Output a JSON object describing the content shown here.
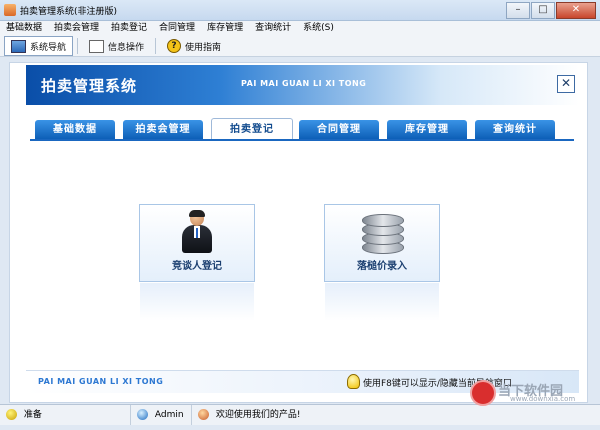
{
  "window": {
    "title": "拍卖管理系统(非注册版)",
    "minimize": "–",
    "maximize": "□",
    "close": "✕"
  },
  "menu": [
    "基础数据",
    "拍卖会管理",
    "拍卖登记",
    "合同管理",
    "库存管理",
    "查询统计",
    "系统(S)"
  ],
  "toolbar": {
    "nav": "系统导航",
    "info": "信息操作",
    "help": "使用指南"
  },
  "banner": {
    "title": "拍卖管理系统",
    "subtitle": "PAI MAI GUAN LI XI TONG",
    "close": "✕"
  },
  "tabs": [
    "基础数据",
    "拍卖会管理",
    "拍卖登记",
    "合同管理",
    "库存管理",
    "查询统计"
  ],
  "active_tab": "拍卖登记",
  "cards": {
    "bidder": "竞谈人登记",
    "hammer": "落槌价录入"
  },
  "footer": {
    "brand": "PAI MAI GUAN LI XI TONG",
    "hint": "使用F8键可以显示/隐藏当前导航窗口"
  },
  "status": {
    "ready": "准备",
    "user": "Admin",
    "welcome": "欢迎使用我们的产品!"
  },
  "watermark": {
    "name": "当下软件园",
    "url": "www.downxia.com"
  },
  "colors": {
    "accent": "#1a67c0",
    "tab": "#0d5fb7",
    "banner": "#0a4ea8"
  }
}
